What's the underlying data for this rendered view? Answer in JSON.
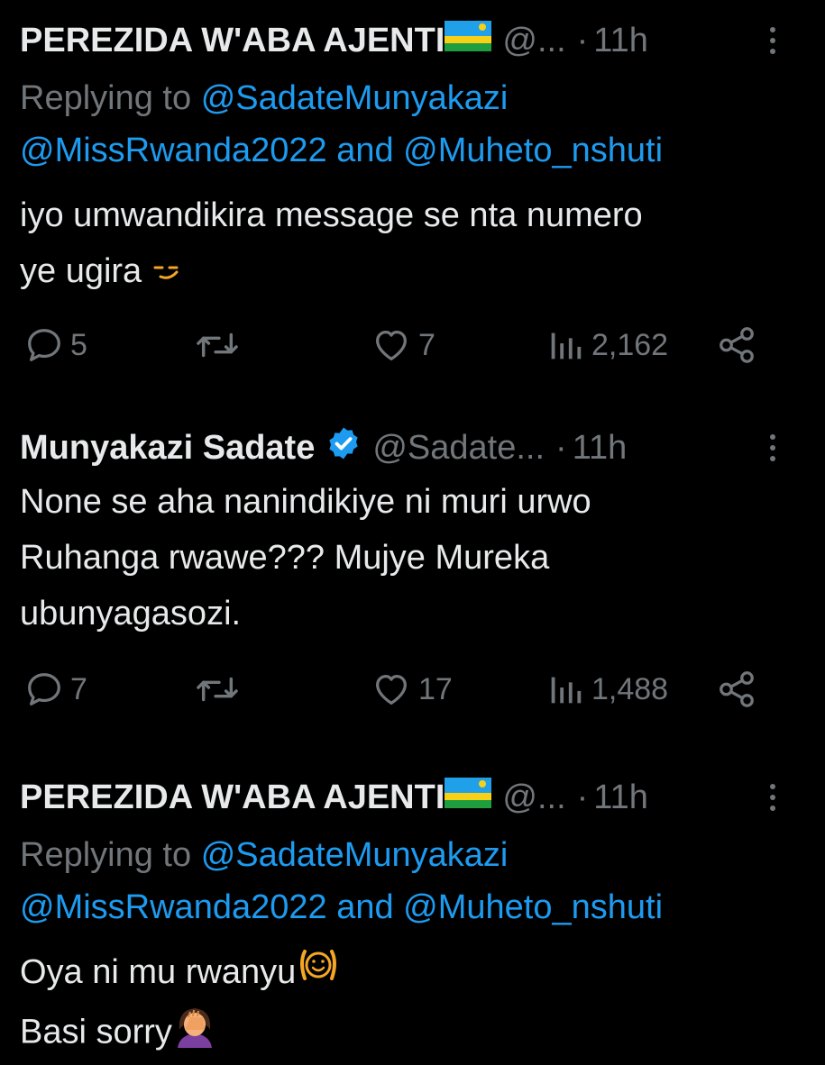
{
  "tweets": [
    {
      "author_name": "PEREZIDA W'ABA AJENTI",
      "flag_icon": "rwanda-flag-icon",
      "handle": "@...",
      "separator": "·",
      "time": "11h",
      "replying_to_label": "Replying to",
      "mention_1": "@SadateMunyakazi",
      "mention_2": "@MissRwanda2022",
      "and_label": "and",
      "mention_3": "@Muheto_nshuti",
      "text_line_1": "iyo umwandikira message se nta numero",
      "text_line_2": "ye ugira",
      "emoji": "smirk-emoji",
      "replies": "5",
      "retweets": "",
      "likes": "7",
      "views": "2,162"
    },
    {
      "author_name": "Munyakazi Sadate",
      "verified_icon": "verified-badge-icon",
      "handle": "@Sadate...",
      "separator": "·",
      "time": "11h",
      "text_line_1": "None se aha nanindikiye ni muri urwo",
      "text_line_2": "Ruhanga rwawe??? Mujye Mureka",
      "text_line_3": "ubunyagasozi.",
      "replies": "7",
      "retweets": "",
      "likes": "17",
      "views": "1,488"
    },
    {
      "author_name": "PEREZIDA W'ABA AJENTI",
      "flag_icon": "rwanda-flag-icon",
      "handle": "@...",
      "separator": "·",
      "time": "11h",
      "replying_to_label": "Replying to",
      "mention_1": "@SadateMunyakazi",
      "mention_2": "@MissRwanda2022",
      "and_label": "and",
      "mention_3": "@Muheto_nshuti",
      "text_line_1": "Oya ni mu rwanyu",
      "text_line_2": "Basi sorry",
      "emoji_1": "hugging-face-emoji",
      "emoji_2": "woman-facepalming-emoji"
    }
  ],
  "colors": {
    "background": "#000000",
    "text": "#e7e9ea",
    "muted": "#71767b",
    "link": "#1d9bf0",
    "verified": "#1d9bf0"
  }
}
